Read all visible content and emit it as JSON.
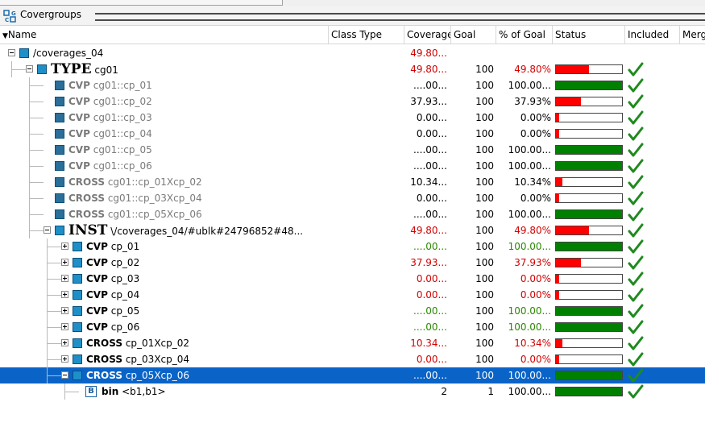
{
  "window": {
    "title": "Covergroups"
  },
  "columns": {
    "name": "Name",
    "class_type": "Class Type",
    "coverage": "Coverage",
    "goal": "Goal",
    "pct_goal": "% of Goal",
    "status": "Status",
    "included": "Included",
    "merge": "Merg"
  },
  "colors": {
    "red": "#d40000",
    "green": "#2a8a00",
    "bar_red": "#ff0000",
    "bar_green": "#008000",
    "selection": "#0a64c8"
  },
  "rows": [
    {
      "depth": 0,
      "expander": "minus",
      "kind": "none",
      "label": "/coverages_04",
      "cov": "49.80...",
      "cov_color": "red",
      "goal": "",
      "pct": "",
      "status": null,
      "included": false
    },
    {
      "depth": 1,
      "expander": "minus",
      "kind": "TYPE",
      "label": "cg01",
      "cov": "49.80...",
      "cov_color": "red",
      "goal": "100",
      "pct": "49.80%",
      "pct_color": "red",
      "status": 0.498,
      "included": true
    },
    {
      "depth": 2,
      "expander": "none",
      "kind": "CVP",
      "label": "cg01::cp_01",
      "cov": "....00...",
      "cov_color": "black",
      "goal": "100",
      "pct": "100.00...",
      "pct_color": "black",
      "status": 1.0,
      "included": true,
      "dim": true
    },
    {
      "depth": 2,
      "expander": "none",
      "kind": "CVP",
      "label": "cg01::cp_02",
      "cov": "37.93...",
      "cov_color": "black",
      "goal": "100",
      "pct": "37.93%",
      "pct_color": "black",
      "status": 0.3793,
      "included": true,
      "dim": true
    },
    {
      "depth": 2,
      "expander": "none",
      "kind": "CVP",
      "label": "cg01::cp_03",
      "cov": "0.00...",
      "cov_color": "black",
      "goal": "100",
      "pct": "0.00%",
      "pct_color": "black",
      "status": 0.0,
      "included": true,
      "dim": true
    },
    {
      "depth": 2,
      "expander": "none",
      "kind": "CVP",
      "label": "cg01::cp_04",
      "cov": "0.00...",
      "cov_color": "black",
      "goal": "100",
      "pct": "0.00%",
      "pct_color": "black",
      "status": 0.0,
      "included": true,
      "dim": true
    },
    {
      "depth": 2,
      "expander": "none",
      "kind": "CVP",
      "label": "cg01::cp_05",
      "cov": "....00...",
      "cov_color": "black",
      "goal": "100",
      "pct": "100.00...",
      "pct_color": "black",
      "status": 1.0,
      "included": true,
      "dim": true
    },
    {
      "depth": 2,
      "expander": "none",
      "kind": "CVP",
      "label": "cg01::cp_06",
      "cov": "....00...",
      "cov_color": "black",
      "goal": "100",
      "pct": "100.00...",
      "pct_color": "black",
      "status": 1.0,
      "included": true,
      "dim": true
    },
    {
      "depth": 2,
      "expander": "none",
      "kind": "CROSS",
      "label": "cg01::cp_01Xcp_02",
      "cov": "10.34...",
      "cov_color": "black",
      "goal": "100",
      "pct": "10.34%",
      "pct_color": "black",
      "status": 0.1034,
      "included": true,
      "dim": true
    },
    {
      "depth": 2,
      "expander": "none",
      "kind": "CROSS",
      "label": "cg01::cp_03Xcp_04",
      "cov": "0.00...",
      "cov_color": "black",
      "goal": "100",
      "pct": "0.00%",
      "pct_color": "black",
      "status": 0.0,
      "included": true,
      "dim": true
    },
    {
      "depth": 2,
      "expander": "none",
      "kind": "CROSS",
      "label": "cg01::cp_05Xcp_06",
      "cov": "....00...",
      "cov_color": "black",
      "goal": "100",
      "pct": "100.00...",
      "pct_color": "black",
      "status": 1.0,
      "included": true,
      "dim": true
    },
    {
      "depth": 2,
      "expander": "minus",
      "kind": "INST",
      "label": "\\/coverages_04/#ublk#24796852#48...",
      "cov": "49.80...",
      "cov_color": "red",
      "goal": "100",
      "pct": "49.80%",
      "pct_color": "red",
      "status": 0.498,
      "included": true
    },
    {
      "depth": 3,
      "expander": "plus",
      "kind": "CVP",
      "label": "cp_01",
      "cov": "....00...",
      "cov_color": "green",
      "goal": "100",
      "pct": "100.00...",
      "pct_color": "green",
      "status": 1.0,
      "included": true
    },
    {
      "depth": 3,
      "expander": "plus",
      "kind": "CVP",
      "label": "cp_02",
      "cov": "37.93...",
      "cov_color": "red",
      "goal": "100",
      "pct": "37.93%",
      "pct_color": "red",
      "status": 0.3793,
      "included": true
    },
    {
      "depth": 3,
      "expander": "plus",
      "kind": "CVP",
      "label": "cp_03",
      "cov": "0.00...",
      "cov_color": "red",
      "goal": "100",
      "pct": "0.00%",
      "pct_color": "red",
      "status": 0.0,
      "included": true
    },
    {
      "depth": 3,
      "expander": "plus",
      "kind": "CVP",
      "label": "cp_04",
      "cov": "0.00...",
      "cov_color": "red",
      "goal": "100",
      "pct": "0.00%",
      "pct_color": "red",
      "status": 0.0,
      "included": true
    },
    {
      "depth": 3,
      "expander": "plus",
      "kind": "CVP",
      "label": "cp_05",
      "cov": "....00...",
      "cov_color": "green",
      "goal": "100",
      "pct": "100.00...",
      "pct_color": "green",
      "status": 1.0,
      "included": true
    },
    {
      "depth": 3,
      "expander": "plus",
      "kind": "CVP",
      "label": "cp_06",
      "cov": "....00...",
      "cov_color": "green",
      "goal": "100",
      "pct": "100.00...",
      "pct_color": "green",
      "status": 1.0,
      "included": true
    },
    {
      "depth": 3,
      "expander": "plus",
      "kind": "CROSS",
      "label": "cp_01Xcp_02",
      "cov": "10.34...",
      "cov_color": "red",
      "goal": "100",
      "pct": "10.34%",
      "pct_color": "red",
      "status": 0.1034,
      "included": true
    },
    {
      "depth": 3,
      "expander": "plus",
      "kind": "CROSS",
      "label": "cp_03Xcp_04",
      "cov": "0.00...",
      "cov_color": "red",
      "goal": "100",
      "pct": "0.00%",
      "pct_color": "red",
      "status": 0.0,
      "included": true
    },
    {
      "depth": 3,
      "expander": "minus",
      "kind": "CROSS",
      "label": "cp_05Xcp_06",
      "cov": "....00...",
      "cov_color": "green",
      "goal": "100",
      "pct": "100.00...",
      "pct_color": "green",
      "status": 1.0,
      "included": true,
      "selected": true
    },
    {
      "depth": 4,
      "expander": "none",
      "kind": "bin",
      "label": "<b1,b1>",
      "cov": "2",
      "cov_color": "black",
      "goal": "1",
      "pct": "100.00...",
      "pct_color": "black",
      "status": 1.0,
      "included": true,
      "bin": true
    }
  ]
}
